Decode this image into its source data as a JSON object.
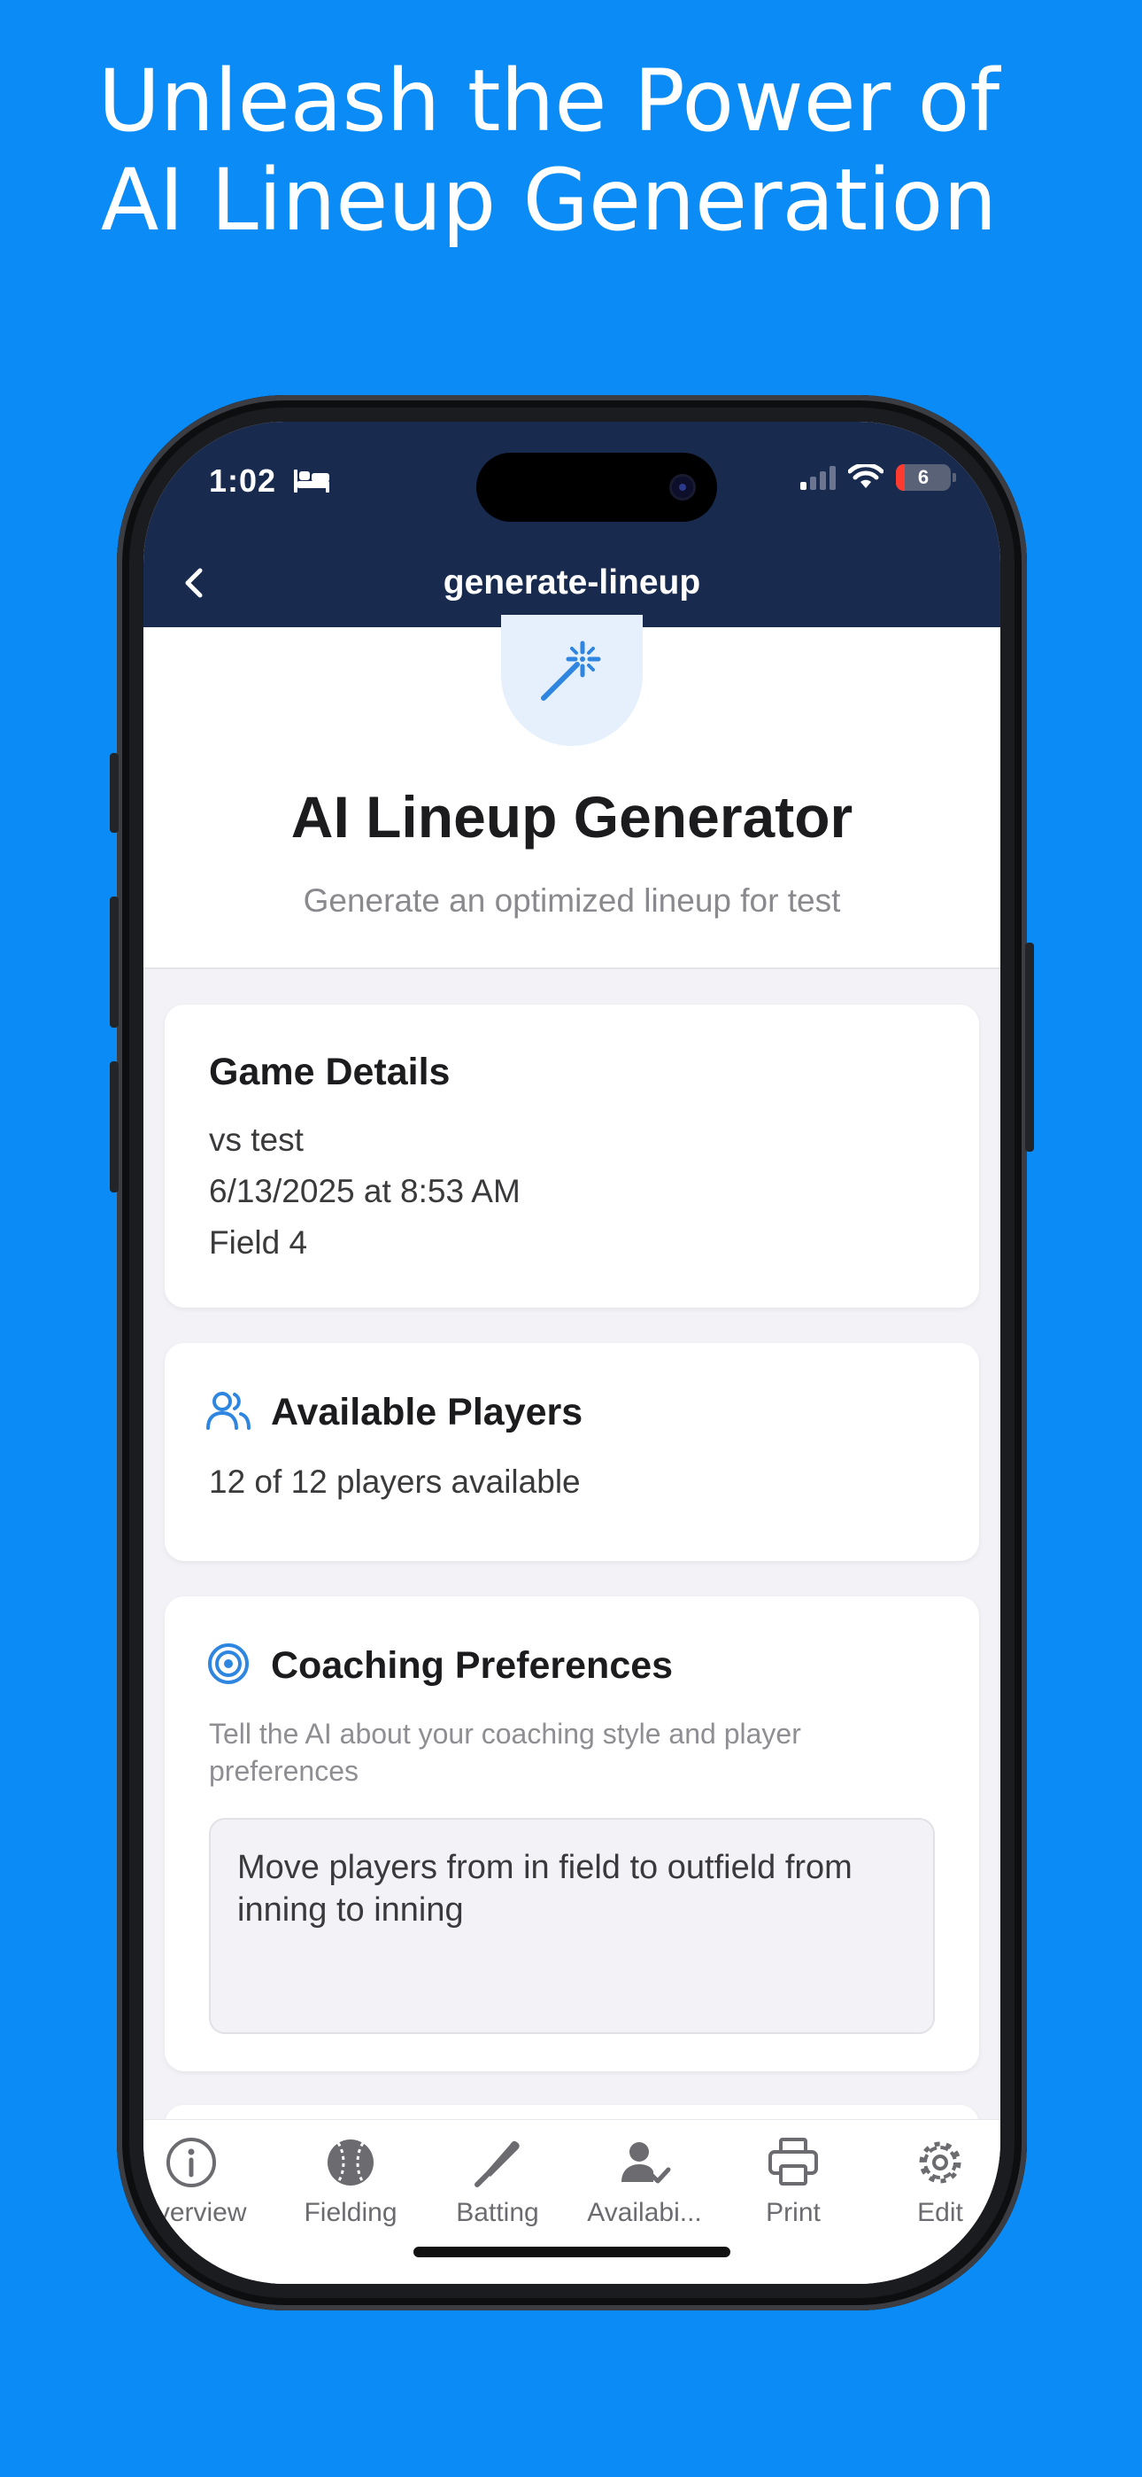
{
  "promo": {
    "headline_line1": "Unleash the Power of",
    "headline_line2": "AI Lineup Generation"
  },
  "status_bar": {
    "time": "1:02",
    "battery": "6",
    "icons": [
      "bed-icon",
      "cellular-signal-icon",
      "wifi-icon",
      "battery-icon"
    ]
  },
  "nav": {
    "title": "generate-lineup",
    "back_icon": "chevron-left-icon"
  },
  "hero": {
    "icon": "magic-wand-icon",
    "title": "AI Lineup Generator",
    "subtitle": "Generate an optimized lineup for test"
  },
  "game_details": {
    "title": "Game Details",
    "opponent": "vs test",
    "datetime": "6/13/2025 at 8:53 AM",
    "field": "Field 4"
  },
  "available_players": {
    "icon": "users-icon",
    "title": "Available Players",
    "summary": "12 of 12 players available"
  },
  "coaching": {
    "icon": "target-icon",
    "title": "Coaching Preferences",
    "hint": "Tell the AI about your coaching style and player preferences",
    "value": "Move players from in field to outfield from inning to inning"
  },
  "tabs": [
    {
      "label": "Overview",
      "icon": "info-icon"
    },
    {
      "label": "Fielding",
      "icon": "baseball-icon"
    },
    {
      "label": "Batting",
      "icon": "bat-icon"
    },
    {
      "label": "Availabi...",
      "icon": "user-check-icon"
    },
    {
      "label": "Print",
      "icon": "printer-icon"
    },
    {
      "label": "Edit",
      "icon": "gear-icon"
    }
  ],
  "colors": {
    "background": "#0a8bf5",
    "nav": "#182a4e",
    "accent": "#2e86e0"
  }
}
